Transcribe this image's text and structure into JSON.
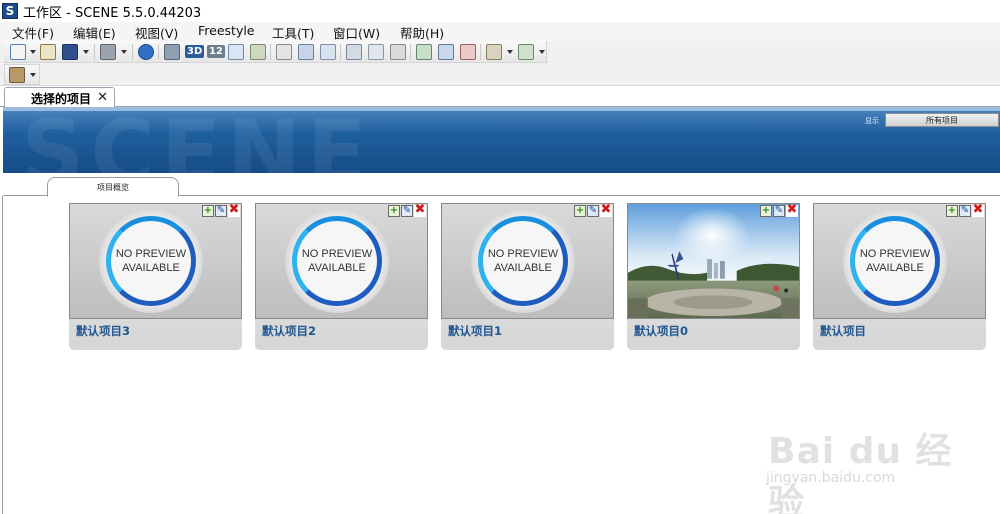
{
  "window": {
    "icon_letter": "S",
    "title": "工作区 - SCENE 5.5.0.44203"
  },
  "menu": [
    "文件(F)",
    "编辑(E)",
    "视图(V)",
    "Freestyle",
    "工具(T)",
    "窗口(W)",
    "帮助(H)"
  ],
  "toolbar": {
    "label_3d": "3D",
    "label_12": "12"
  },
  "document_tab": {
    "label": "选择的项目",
    "close": "✕"
  },
  "banner": {
    "wordmark": "SCENE",
    "display_label": "显示",
    "all_projects_button": "所有项目"
  },
  "sub_tab": {
    "label": "项目概览"
  },
  "projects": [
    {
      "name": "默认项目3",
      "preview": "NO PREVIEW AVAILABLE"
    },
    {
      "name": "默认项目2",
      "preview": "NO PREVIEW AVAILABLE"
    },
    {
      "name": "默认项目1",
      "preview": "NO PREVIEW AVAILABLE"
    },
    {
      "name": "默认项目0",
      "preview": "panorama"
    },
    {
      "name": "默认项目",
      "preview": "NO PREVIEW AVAILABLE"
    }
  ],
  "no_preview": {
    "line1": "NO PREVIEW",
    "line2": "AVAILABLE"
  },
  "watermark": {
    "main": "Bai du 经验",
    "url": "jingyan.baidu.com"
  },
  "colors": {
    "banner_blue": "#1f5f9e",
    "ring_blue": "#1e5cc0",
    "title_blue": "#1f5590",
    "delete_red": "#d01c1c"
  }
}
